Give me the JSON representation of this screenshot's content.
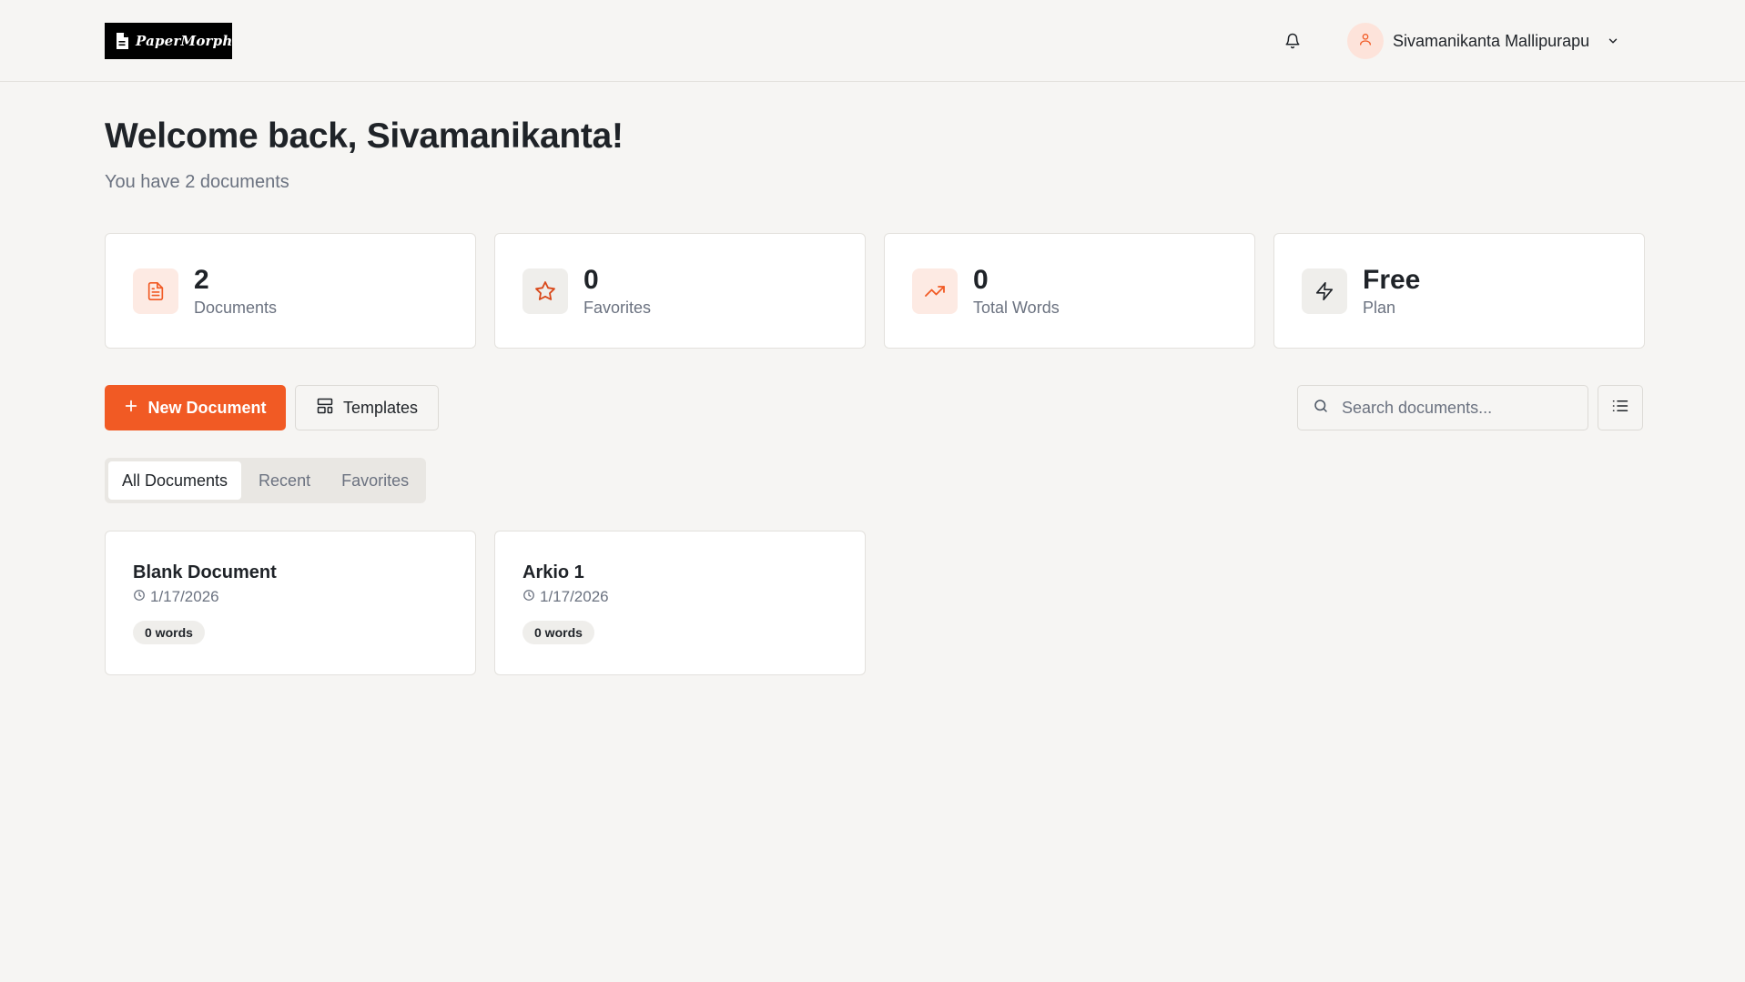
{
  "header": {
    "logo_text": "PaperMorph",
    "user_name": "Sivamanikanta Mallipurapu"
  },
  "welcome": {
    "title": "Welcome back, Sivamanikanta!",
    "subtitle": "You have 2 documents"
  },
  "stats": [
    {
      "value": "2",
      "label": "Documents",
      "icon": "document-icon"
    },
    {
      "value": "0",
      "label": "Favorites",
      "icon": "star-icon"
    },
    {
      "value": "0",
      "label": "Total Words",
      "icon": "trending-up-icon"
    },
    {
      "value": "Free",
      "label": "Plan",
      "icon": "lightning-icon"
    }
  ],
  "actions": {
    "new_document": "New Document",
    "templates": "Templates",
    "search_placeholder": "Search documents..."
  },
  "tabs": [
    {
      "label": "All Documents",
      "active": true
    },
    {
      "label": "Recent",
      "active": false
    },
    {
      "label": "Favorites",
      "active": false
    }
  ],
  "documents": [
    {
      "title": "Blank Document",
      "date": "1/17/2026",
      "words": "0 words"
    },
    {
      "title": "Arkio 1",
      "date": "1/17/2026",
      "words": "0 words"
    }
  ],
  "colors": {
    "accent": "#f15a24",
    "background": "#f6f5f3",
    "card": "#ffffff",
    "muted_text": "#6b7280"
  }
}
